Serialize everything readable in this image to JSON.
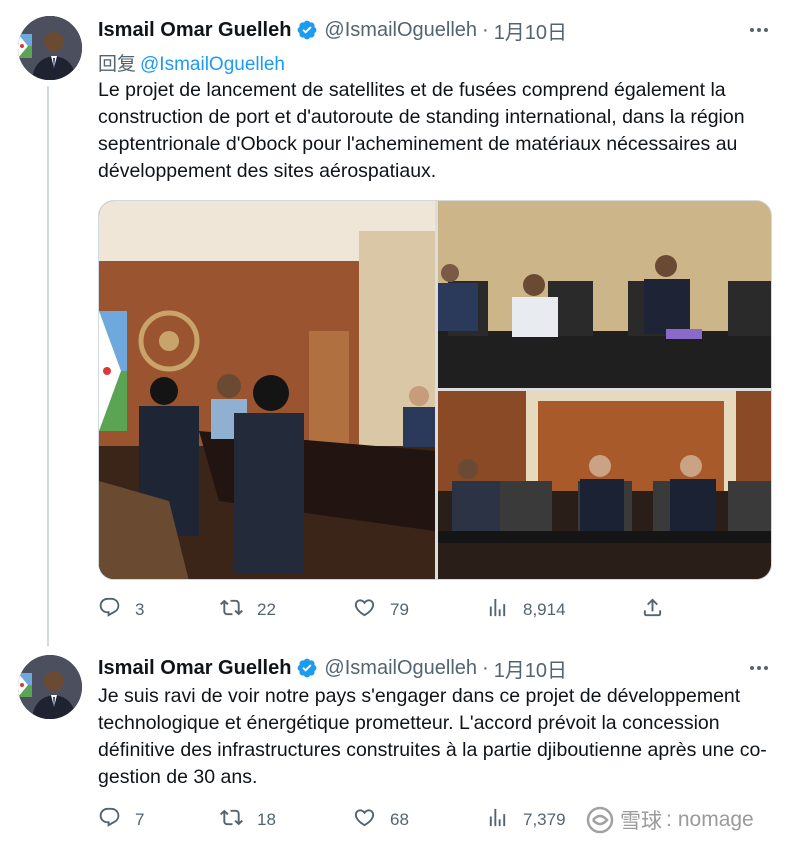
{
  "tweet1": {
    "author_name": "Ismail Omar Guelleh",
    "handle": "@IsmailOguelleh",
    "dot": "·",
    "date": "1月10日",
    "reply_prefix": "回复",
    "reply_to": "@IsmailOguelleh",
    "text": "Le projet de lancement de satellites et de fusées comprend également la construction de port et d'autoroute de standing international, dans la région septentrionale d'Obock pour l'acheminement de matériaux nécessaires au développement des sites aérospatiaux.",
    "replies": "3",
    "retweets": "22",
    "likes": "79",
    "views": "8,914"
  },
  "tweet2": {
    "author_name": "Ismail Omar Guelleh",
    "handle": "@IsmailOguelleh",
    "dot": "·",
    "date": "1月10日",
    "text": "Je suis ravi de voir notre pays s'engager dans ce projet de développement technologique et énergétique prometteur. L'accord prévoit la concession définitive des infrastructures construites à la partie djiboutienne après une co-gestion de 30 ans.",
    "replies": "7",
    "retweets": "18",
    "likes": "68",
    "views": "7,379"
  },
  "watermark": {
    "brand_cn": "雪球",
    "separator": ":",
    "user": "nomage"
  },
  "colors": {
    "text_primary": "#0f1419",
    "text_secondary": "#536471",
    "link": "#1d9bf0",
    "verified": "#1d9bf0",
    "thread_line": "#cfd9de"
  },
  "icons": [
    "verified-badge-icon",
    "more-icon",
    "reply-icon",
    "retweet-icon",
    "like-icon",
    "views-icon",
    "share-icon"
  ]
}
